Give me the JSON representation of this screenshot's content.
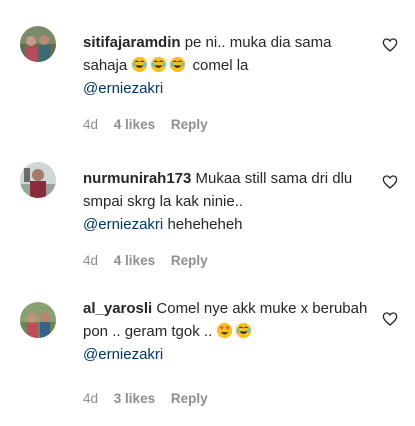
{
  "comments": [
    {
      "username": "sitifajaramdin",
      "text_before": "pe ni.. muka dia sama sahaja",
      "emojis": [
        "laughing-tears-emoji",
        "laughing-tears-emoji",
        "laughing-tears-emoji"
      ],
      "text_after": "comel la",
      "mention": "@erniezakri",
      "trailing": "",
      "time": "4d",
      "likes": "4 likes",
      "reply": "Reply"
    },
    {
      "username": "nurmunirah173",
      "text_before": "Mukaa still sama dri dlu smpai skrg la kak ninie..",
      "emojis": [],
      "text_after": "",
      "mention": "@erniezakri",
      "trailing": "heheheheh",
      "time": "4d",
      "likes": "4 likes",
      "reply": "Reply"
    },
    {
      "username": "al_yarosli",
      "text_before": "Comel nye akk muke x berubah pon .. geram tgok ..",
      "emojis": [
        "heart-eyes-emoji",
        "laughing-tears-emoji"
      ],
      "text_after": "",
      "mention": "@erniezakri",
      "trailing": "",
      "time": "4d",
      "likes": "3 likes",
      "reply": "Reply"
    }
  ],
  "colors": {
    "text": "#262626",
    "muted": "#8e8e8e",
    "mention": "#00376b"
  }
}
